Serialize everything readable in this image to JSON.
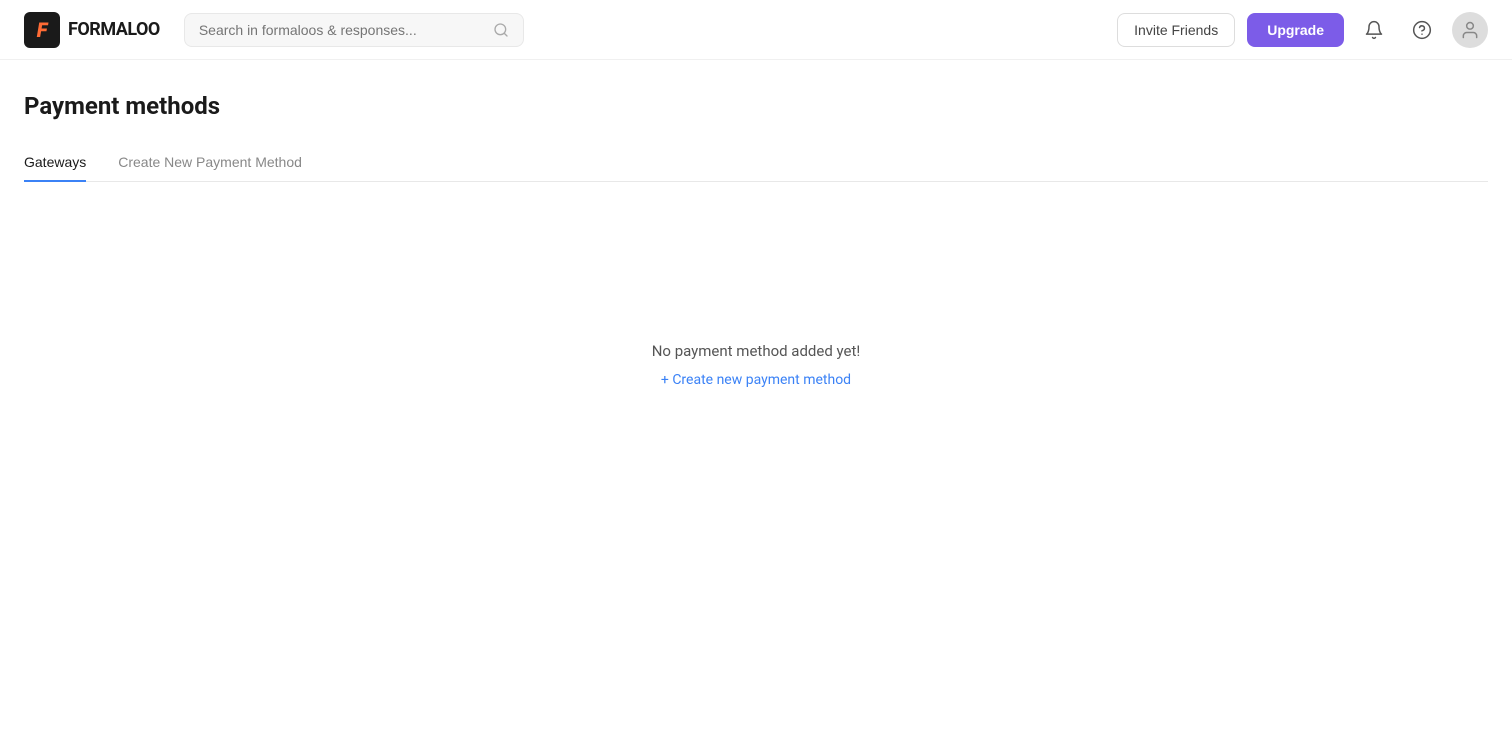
{
  "header": {
    "logo_text": "FORMALOO",
    "search_placeholder": "Search in formaloos & responses...",
    "invite_label": "Invite Friends",
    "upgrade_label": "Upgrade"
  },
  "page": {
    "title": "Payment methods"
  },
  "tabs": [
    {
      "id": "gateways",
      "label": "Gateways",
      "active": true
    },
    {
      "id": "create",
      "label": "Create New Payment Method",
      "active": false
    }
  ],
  "empty_state": {
    "message": "No payment method added yet!",
    "create_link": "+ Create new payment method"
  }
}
